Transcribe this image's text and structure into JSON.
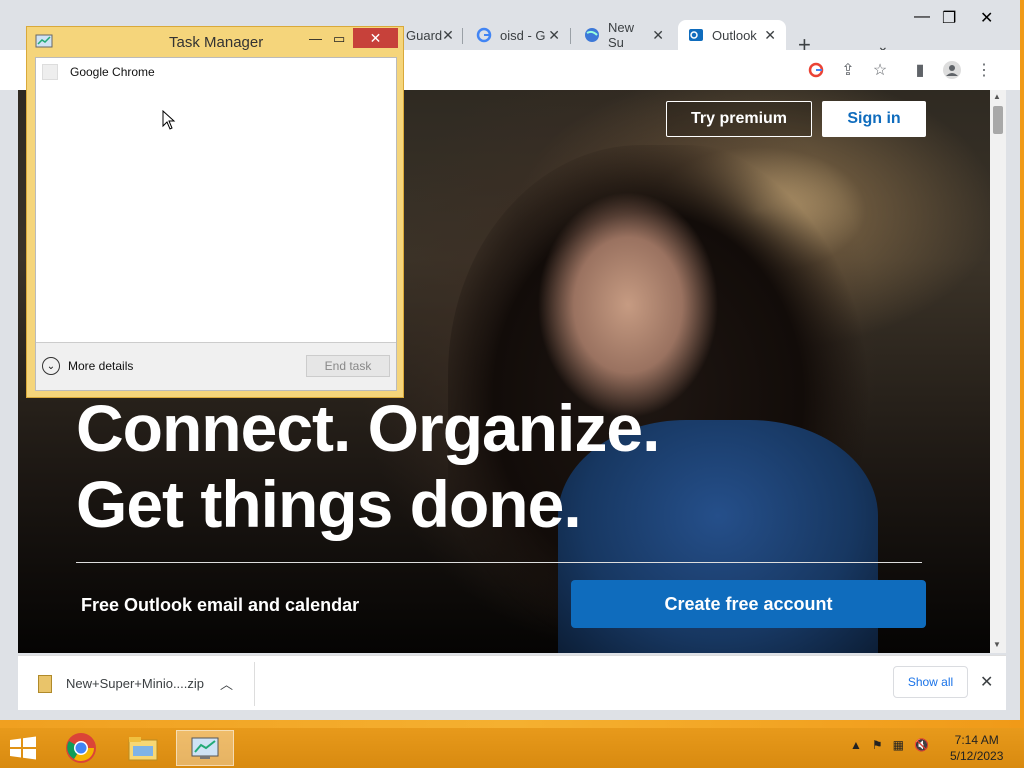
{
  "browser": {
    "tabs": [
      {
        "label": "Guard",
        "icon": "shield-icon"
      },
      {
        "label": "oisd - G",
        "icon": "google-icon"
      },
      {
        "label": "New Su",
        "icon": "globe-icon"
      },
      {
        "label": "Outlook",
        "icon": "outlook-icon",
        "active": true
      }
    ],
    "new_tab": "+",
    "window_controls": {
      "minimize": "—",
      "maximize": "❐",
      "close": "✕"
    }
  },
  "page": {
    "try_premium": "Try premium",
    "sign_in": "Sign in",
    "headline_line1": "Connect. Organize.",
    "headline_line2": "Get things done.",
    "subtext": "Free Outlook email and calendar",
    "create_account": "Create free account"
  },
  "download_bar": {
    "file_name": "New+Super+Minio....zip",
    "show_all": "Show all"
  },
  "task_manager": {
    "title": "Task Manager",
    "process": "Google Chrome",
    "more_details": "More details",
    "end_task": "End task"
  },
  "taskbar": {
    "time": "7:14 AM",
    "date": "5/12/2023"
  },
  "colors": {
    "accent": "#0f6cbd",
    "taskbar": "#e89a1b",
    "tm_frame": "#f5d57b",
    "close_red": "#c7413a"
  }
}
